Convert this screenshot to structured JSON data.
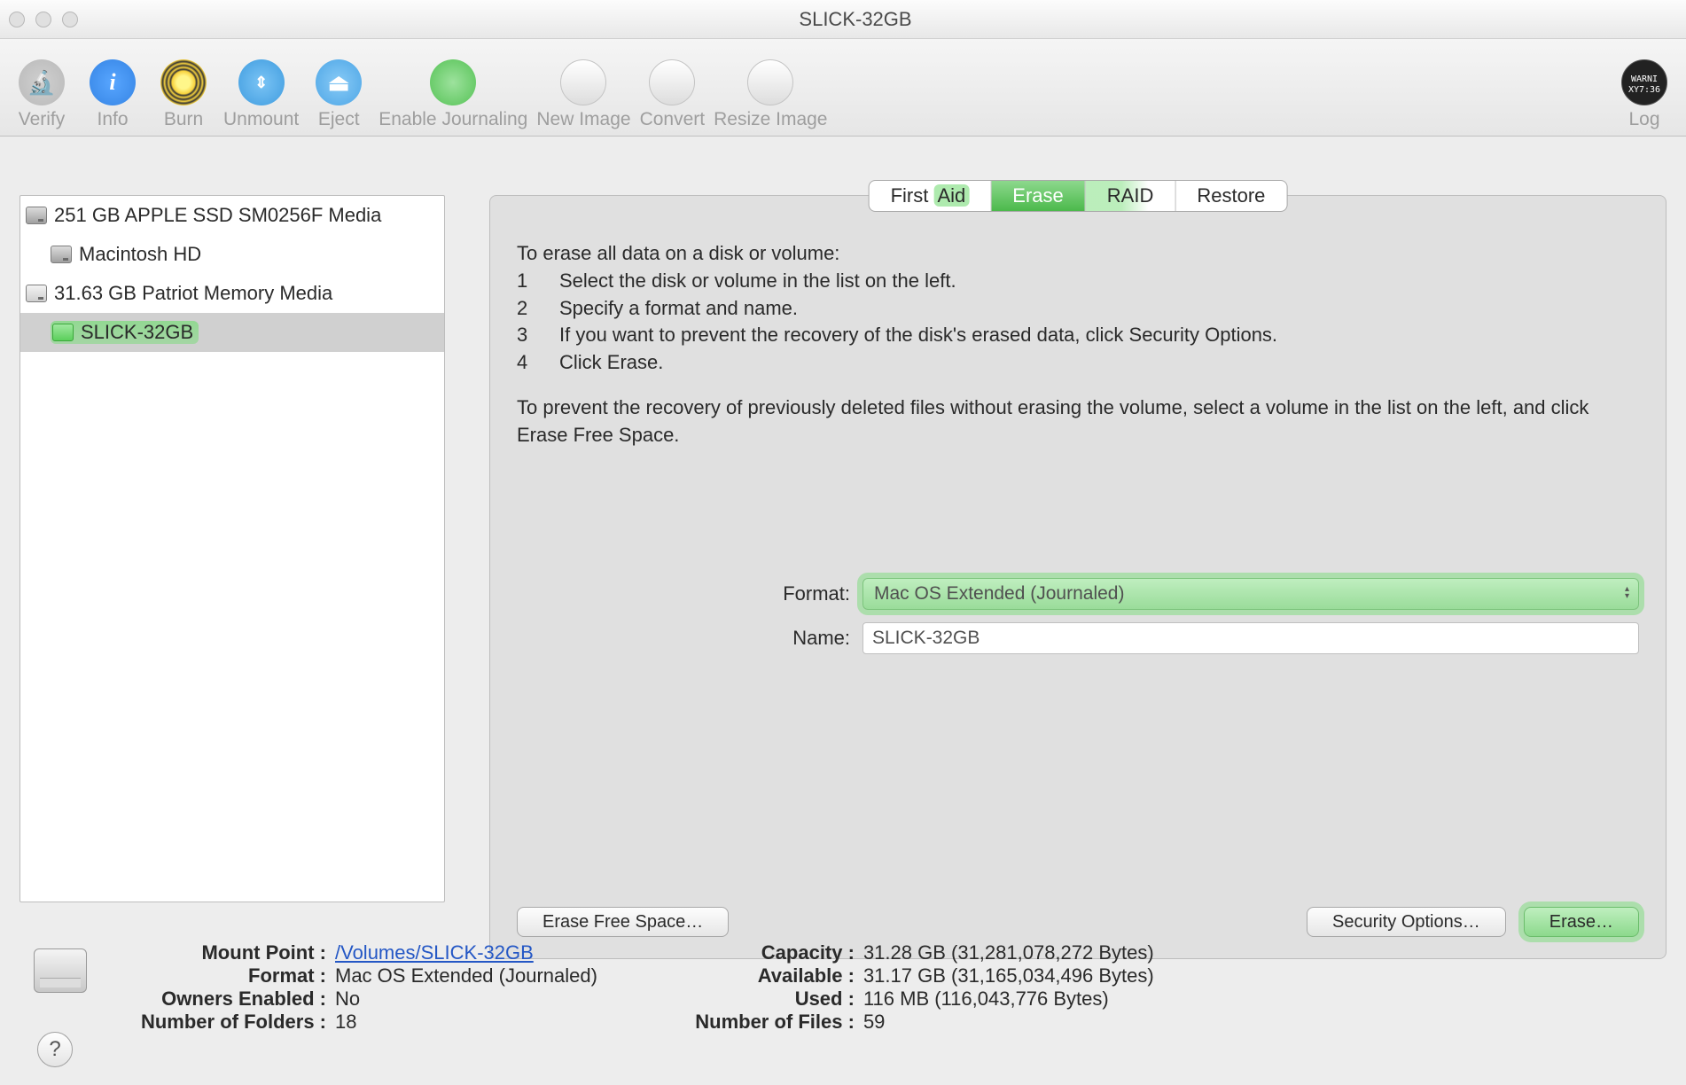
{
  "window_title": "SLICK-32GB",
  "toolbar": {
    "verify": "Verify",
    "info": "Info",
    "burn": "Burn",
    "unmount": "Unmount",
    "eject": "Eject",
    "journal": "Enable Journaling",
    "newimage": "New Image",
    "convert": "Convert",
    "resize": "Resize Image",
    "log": "Log"
  },
  "sidebar": {
    "items": [
      {
        "label": "251 GB APPLE SSD SM0256F Media"
      },
      {
        "label": "Macintosh HD"
      },
      {
        "label": "31.63 GB Patriot Memory Media"
      },
      {
        "label": "SLICK-32GB"
      }
    ]
  },
  "tabs": {
    "first_aid": "First Aid",
    "erase": "Erase",
    "raid": "RAID",
    "restore": "Restore"
  },
  "instructions": {
    "intro": "To erase all data on a disk or volume:",
    "n1": "1",
    "s1": "Select the disk or volume in the list on the left.",
    "n2": "2",
    "s2": "Specify a format and name.",
    "n3": "3",
    "s3": "If you want to prevent the recovery of the disk's erased data, click Security Options.",
    "n4": "4",
    "s4": "Click Erase.",
    "para": "To prevent the recovery of previously deleted files without erasing the volume, select a volume in the list on the left, and click Erase Free Space."
  },
  "form": {
    "format_label": "Format:",
    "format_value": "Mac OS Extended (Journaled)",
    "name_label": "Name:",
    "name_value": "SLICK-32GB"
  },
  "buttons": {
    "erase_free_space": "Erase Free Space…",
    "security_options": "Security Options…",
    "erase": "Erase…"
  },
  "summary": {
    "mount_point_k": "Mount Point :",
    "mount_point_v": "/Volumes/SLICK-32GB",
    "format_k": "Format :",
    "format_v": "Mac OS Extended (Journaled)",
    "owners_k": "Owners Enabled :",
    "owners_v": "No",
    "folders_k": "Number of Folders :",
    "folders_v": "18",
    "capacity_k": "Capacity :",
    "capacity_v": "31.28 GB (31,281,078,272 Bytes)",
    "available_k": "Available :",
    "available_v": "31.17 GB (31,165,034,496 Bytes)",
    "used_k": "Used :",
    "used_v": "116 MB (116,043,776 Bytes)",
    "files_k": "Number of Files :",
    "files_v": "59"
  },
  "help": "?"
}
